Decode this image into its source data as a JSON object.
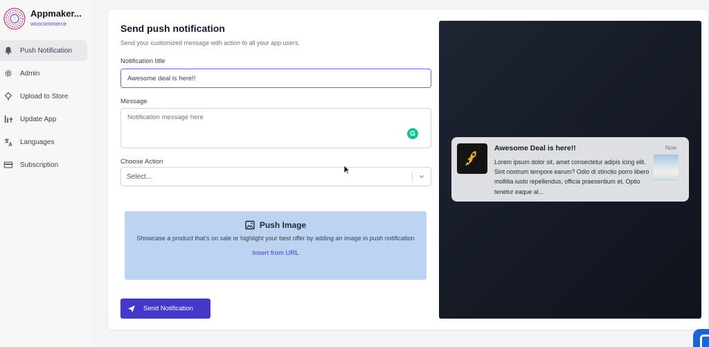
{
  "brand": {
    "name": "Appmaker...",
    "sub": "woocommerce"
  },
  "sidebar": {
    "items": [
      {
        "label": "Push Notification",
        "icon": "bell-icon",
        "active": true
      },
      {
        "label": "Admin",
        "icon": "gear-icon"
      },
      {
        "label": "Upload to Store",
        "icon": "upload-icon"
      },
      {
        "label": "Update App",
        "icon": "update-icon"
      },
      {
        "label": "Languages",
        "icon": "translate-icon"
      },
      {
        "label": "Subscription",
        "icon": "card-icon"
      }
    ]
  },
  "form": {
    "title": "Send push notification",
    "subtitle": "Send your customized message with action to all your app users.",
    "title_label": "Notification title",
    "title_value": "Awesome deal is here!!",
    "message_label": "Message",
    "message_placeholder": "Notification message here",
    "action_label": "Choose Action",
    "action_value": "Select...",
    "push_image": {
      "title": "Push Image",
      "description": "Showcase a product that's on sale or highlight your best offer by adding an image in push notification",
      "link": "Insert from URL"
    },
    "send_label": "Send Notification"
  },
  "preview": {
    "title": "Awesome Deal is here!!",
    "time": "Now",
    "body": "Lorem ipsum dolor sit, amet consectetur adipis icing elit. Sint nostrum tempore earum? Odio di stinctio porro libero mollitia iusto repellendus, officia praesentium et. Optio tenetur eaque al..."
  },
  "colors": {
    "accent": "#4338ca",
    "focus_border": "#6366f1",
    "image_box": "#bcd3f2",
    "preview_bg": "#1a1f2b",
    "notification_bg": "#dedfe3"
  }
}
